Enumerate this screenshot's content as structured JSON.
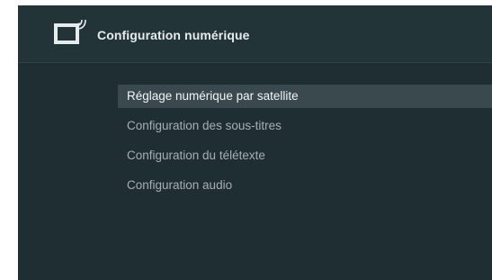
{
  "header": {
    "title": "Configuration numérique",
    "icon": "tv-antenna-icon"
  },
  "menu": {
    "items": [
      {
        "label": "Réglage numérique par satellite",
        "selected": true
      },
      {
        "label": "Configuration des sous-titres",
        "selected": false
      },
      {
        "label": "Configuration du télétexte",
        "selected": false
      },
      {
        "label": "Configuration audio",
        "selected": false
      }
    ]
  },
  "colors": {
    "panel_background": "#1f2e33",
    "header_background": "#233439",
    "selection_highlight": "#3a494e",
    "text_active": "#f2f5f6",
    "text_inactive": "#a4b0b4"
  }
}
